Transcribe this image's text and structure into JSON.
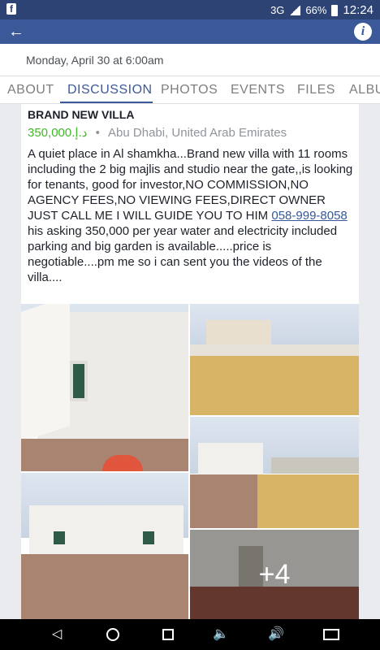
{
  "status": {
    "network": "3G",
    "battery": "66%",
    "time": "12:24"
  },
  "icons": {
    "app": "facebook-icon",
    "back": "back-arrow-icon",
    "info": "info-icon"
  },
  "header": {
    "date": "Monday, April 30 at 6:00am"
  },
  "tabs": [
    {
      "label": "ABOUT",
      "active": false
    },
    {
      "label": "DISCUSSION",
      "active": true
    },
    {
      "label": "PHOTOS",
      "active": false
    },
    {
      "label": "EVENTS",
      "active": false
    },
    {
      "label": "FILES",
      "active": false
    },
    {
      "label": "ALBU",
      "active": false
    }
  ],
  "post": {
    "title": "BRAND NEW VILLA",
    "price": "350,000د.إ.‏",
    "separator": "•",
    "location": "Abu Dhabi, United Arab Emirates",
    "desc_before": "A quiet place in Al shamkha...Brand new villa with 11 rooms including the 2 big majlis and studio near the gate,,is looking for tenants, good for investor,NO COMMISSION,NO AGENCY FEES,NO VIEWING FEES,DIRECT OWNER JUST CALL ME I WILL GUIDE YOU TO HIM ",
    "phone": "058-999-8058",
    "desc_after": " his asking 350,000 per year water and electricity included parking and big garden is available.....price is negotiable....pm me so i can sent you the videos of the villa....",
    "more_photos": "+4"
  },
  "colors": {
    "facebook_blue": "#3b5998",
    "price_green": "#42b72a",
    "link": "#365899"
  },
  "navbar": {
    "back": "nav-back-icon",
    "home": "nav-home-icon",
    "recents": "nav-recents-icon",
    "vol_down": "volume-down-icon",
    "vol_up": "volume-up-icon",
    "screenshot": "screenshot-icon"
  }
}
